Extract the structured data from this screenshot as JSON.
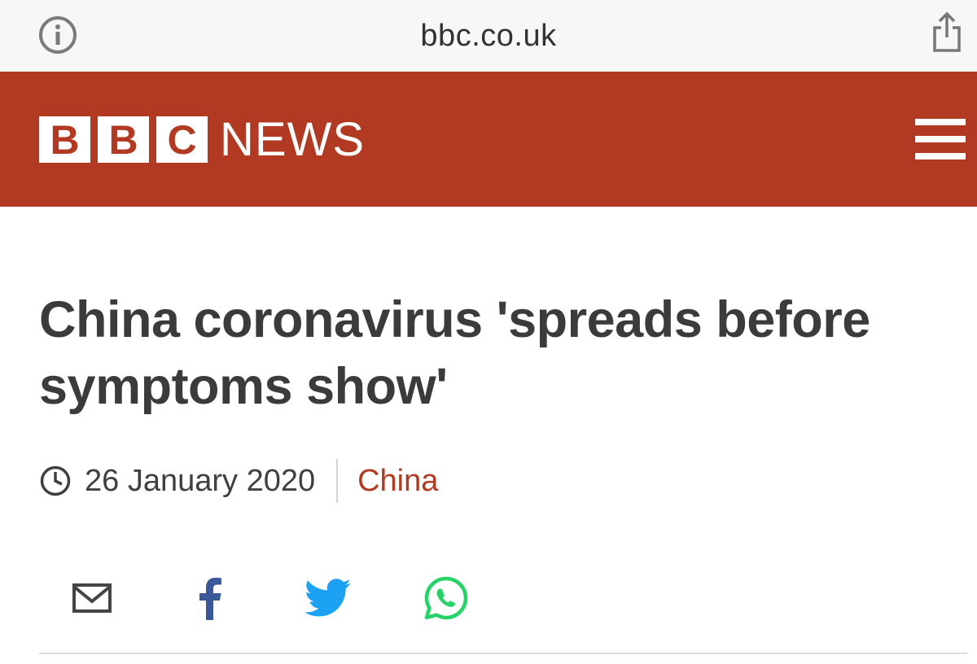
{
  "browser": {
    "url": "bbc.co.uk",
    "info_icon": "info-icon",
    "share_icon": "share-icon"
  },
  "header": {
    "logo_letters": [
      "B",
      "B",
      "C"
    ],
    "logo_word": "NEWS",
    "menu_icon": "hamburger-menu-icon",
    "background_color": "#b33a22"
  },
  "article": {
    "headline": "China coronavirus 'spreads before symptoms show'",
    "date": "26 January 2020",
    "section": "China",
    "section_color": "#b33a22"
  },
  "share": {
    "icons": [
      "email-icon",
      "facebook-icon",
      "twitter-icon",
      "whatsapp-icon"
    ],
    "colors": {
      "email": "#444444",
      "facebook": "#3b5998",
      "twitter": "#1da1f2",
      "whatsapp": "#25d366"
    }
  }
}
